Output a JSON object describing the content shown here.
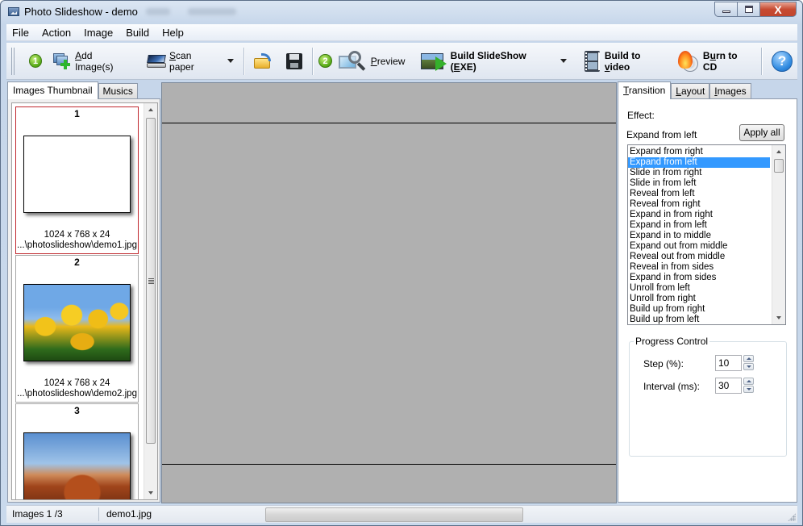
{
  "window": {
    "title": "Photo Slideshow - demo",
    "controls": {
      "minimize": "minimize",
      "maximize": "maximize",
      "close": "X"
    }
  },
  "menu": [
    "File",
    "Action",
    "Image",
    "Build",
    "Help"
  ],
  "toolbar": {
    "step1": "1",
    "add_images": {
      "prefix": "",
      "accel": "A",
      "rest": "dd Image(s)"
    },
    "scan_paper": {
      "accel": "S",
      "rest": "can paper"
    },
    "step2": "2",
    "preview": {
      "accel": "P",
      "rest": "review"
    },
    "build_exe": {
      "before": "Build SlideShow (",
      "accel": "E",
      "after": "XE)"
    },
    "build_video": {
      "before": "Build to ",
      "accel": "v",
      "after": "ideo"
    },
    "burn_cd": {
      "before": "B",
      "accel": "u",
      "after": "rn to CD"
    },
    "help": "?"
  },
  "left_panel": {
    "tabs": [
      {
        "label": "Images Thumbnail",
        "active": true
      },
      {
        "label": "Musics",
        "active": false
      }
    ],
    "thumbnails": [
      {
        "index": "1",
        "info": "1024 x 768 x 24",
        "path": "...\\photoslideshow\\demo1.jpg",
        "selected": true
      },
      {
        "index": "2",
        "info": "1024 x 768 x 24",
        "path": "...\\photoslideshow\\demo2.jpg",
        "selected": false
      },
      {
        "index": "3",
        "info": "",
        "path": "",
        "selected": false
      }
    ]
  },
  "right_panel": {
    "tabs": [
      {
        "accel": "T",
        "rest": "ransition",
        "active": true
      },
      {
        "accel": "L",
        "rest": "ayout",
        "active": false
      },
      {
        "accel": "I",
        "rest": "mages",
        "active": false
      }
    ],
    "effect_label": "Effect:",
    "effect_current": "Expand from left",
    "apply_all": "Apply all",
    "effects": [
      "Expand from right",
      "Expand from left",
      "Slide in from right",
      "Slide in from left",
      "Reveal from left",
      "Reveal from right",
      "Expand in from right",
      "Expand in from left",
      "Expand in to middle",
      "Expand out from middle",
      "Reveal out from middle",
      "Reveal in from sides",
      "Expand in from sides",
      "Unroll from left",
      "Unroll from right",
      "Build up from right",
      "Build up from left"
    ],
    "selected_effect_index": 1,
    "progress_control": {
      "title": "Progress Control",
      "step_label": "Step (%):",
      "step_value": "10",
      "interval_label": "Interval (ms):",
      "interval_value": "30"
    }
  },
  "status": {
    "images": "Images 1 /3",
    "filename": "demo1.jpg"
  }
}
